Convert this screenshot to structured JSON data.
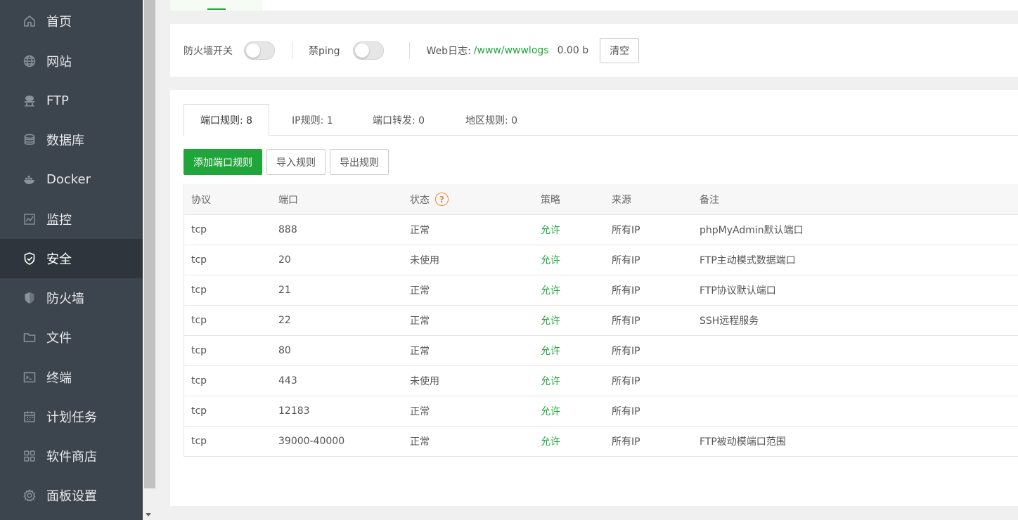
{
  "sidebar": {
    "items": [
      {
        "label": "首页",
        "icon": "home-icon",
        "active": false
      },
      {
        "label": "网站",
        "icon": "globe-icon",
        "active": false
      },
      {
        "label": "FTP",
        "icon": "ftp-icon",
        "active": false
      },
      {
        "label": "数据库",
        "icon": "database-icon",
        "active": false
      },
      {
        "label": "Docker",
        "icon": "docker-icon",
        "active": false
      },
      {
        "label": "监控",
        "icon": "monitor-icon",
        "active": false
      },
      {
        "label": "安全",
        "icon": "shield-check-icon",
        "active": true
      },
      {
        "label": "防火墙",
        "icon": "firewall-shield-icon",
        "active": false
      },
      {
        "label": "文件",
        "icon": "folder-icon",
        "active": false
      },
      {
        "label": "终端",
        "icon": "terminal-icon",
        "active": false
      },
      {
        "label": "计划任务",
        "icon": "calendar-icon",
        "active": false
      },
      {
        "label": "软件商店",
        "icon": "apps-grid-icon",
        "active": false
      },
      {
        "label": "面板设置",
        "icon": "gear-icon",
        "active": false
      }
    ]
  },
  "firewall": {
    "switch_label": "防火墙开关",
    "switch_on": false,
    "ping_label": "禁ping",
    "ping_on": false,
    "weblog_label": "Web日志:",
    "weblog_path": "/www/wwwlogs",
    "weblog_size": "0.00 b",
    "clear_label": "清空"
  },
  "tabs": [
    {
      "label": "端口规则: 8",
      "active": true
    },
    {
      "label": "IP规则: 1",
      "active": false
    },
    {
      "label": "端口转发: 0",
      "active": false
    },
    {
      "label": "地区规则: 0",
      "active": false
    }
  ],
  "actions": {
    "add_label": "添加端口规则",
    "import_label": "导入规则",
    "export_label": "导出规则"
  },
  "table": {
    "headers": {
      "protocol": "协议",
      "port": "端口",
      "status": "状态",
      "help": "?",
      "policy": "策略",
      "source": "来源",
      "note": "备注"
    },
    "rows": [
      {
        "protocol": "tcp",
        "port": "888",
        "status": "正常",
        "policy": "允许",
        "source": "所有IP",
        "note": "phpMyAdmin默认端口"
      },
      {
        "protocol": "tcp",
        "port": "20",
        "status": "未使用",
        "policy": "允许",
        "source": "所有IP",
        "note": "FTP主动模式数据端口"
      },
      {
        "protocol": "tcp",
        "port": "21",
        "status": "正常",
        "policy": "允许",
        "source": "所有IP",
        "note": "FTP协议默认端口"
      },
      {
        "protocol": "tcp",
        "port": "22",
        "status": "正常",
        "policy": "允许",
        "source": "所有IP",
        "note": "SSH远程服务"
      },
      {
        "protocol": "tcp",
        "port": "80",
        "status": "正常",
        "policy": "允许",
        "source": "所有IP",
        "note": ""
      },
      {
        "protocol": "tcp",
        "port": "443",
        "status": "未使用",
        "policy": "允许",
        "source": "所有IP",
        "note": ""
      },
      {
        "protocol": "tcp",
        "port": "12183",
        "status": "正常",
        "policy": "允许",
        "source": "所有IP",
        "note": ""
      },
      {
        "protocol": "tcp",
        "port": "39000-40000",
        "status": "正常",
        "policy": "允许",
        "source": "所有IP",
        "note": "FTP被动模端口范围"
      }
    ]
  },
  "colors": {
    "sidebar_bg": "#3c444d",
    "sidebar_active_bg": "#2e353c",
    "accent_green": "#20a53a",
    "help_orange": "#f0883a"
  }
}
